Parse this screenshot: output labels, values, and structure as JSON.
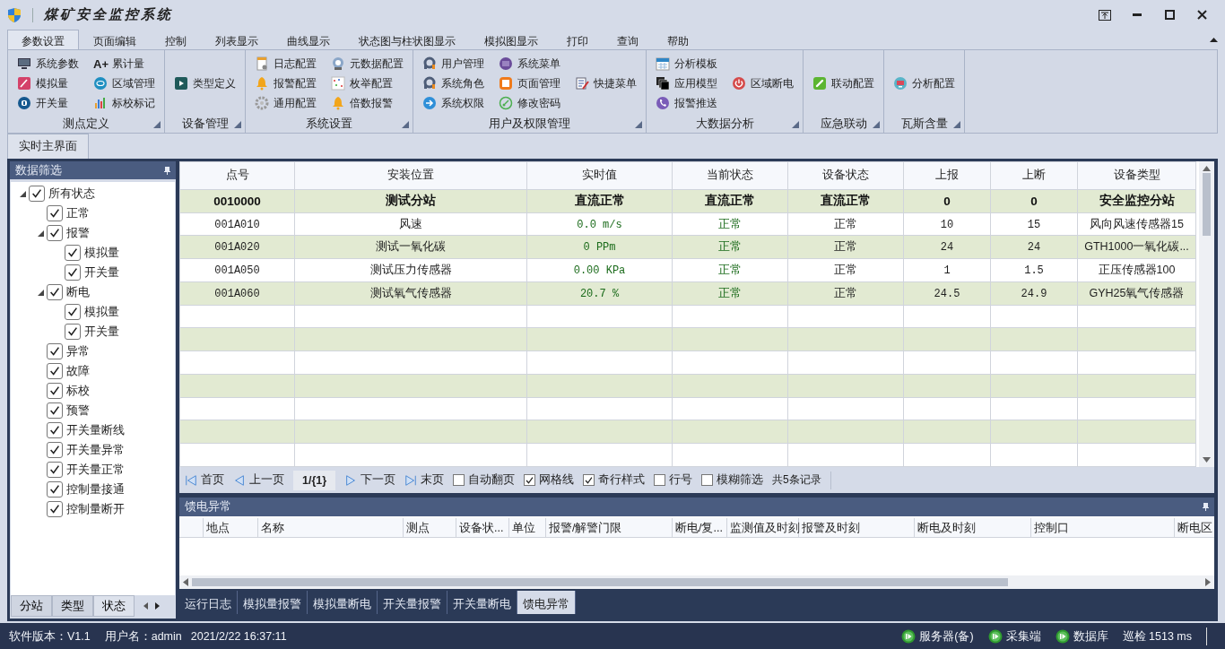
{
  "window": {
    "title": "煤矿安全监控系统"
  },
  "ribbon": {
    "tabs": [
      {
        "label": "参数设置",
        "selected": true
      },
      {
        "label": "页面编辑",
        "selected": false
      },
      {
        "label": "控制",
        "selected": false
      },
      {
        "label": "列表显示",
        "selected": false
      },
      {
        "label": "曲线显示",
        "selected": false
      },
      {
        "label": "状态图与柱状图显示",
        "selected": false
      },
      {
        "label": "模拟图显示",
        "selected": false
      },
      {
        "label": "打印",
        "selected": false
      },
      {
        "label": "查询",
        "selected": false
      },
      {
        "label": "帮助",
        "selected": false
      }
    ],
    "groups": [
      {
        "label": "测点定义",
        "columns": [
          [
            {
              "label": "系统参数"
            },
            {
              "label": "模拟量"
            },
            {
              "label": "开关量"
            }
          ],
          [
            {
              "label": "累计量",
              "icon_text": "A+"
            },
            {
              "label": "区域管理"
            },
            {
              "label": "标校标记"
            }
          ]
        ]
      },
      {
        "label": "设备管理",
        "columns": [
          [
            {
              "label": "类型定义"
            }
          ]
        ]
      },
      {
        "label": "系统设置",
        "columns": [
          [
            {
              "label": "日志配置"
            },
            {
              "label": "报警配置"
            },
            {
              "label": "通用配置"
            }
          ],
          [
            {
              "label": "元数据配置"
            },
            {
              "label": "枚举配置"
            },
            {
              "label": "倍数报警"
            }
          ]
        ]
      },
      {
        "label": "用户及权限管理",
        "columns": [
          [
            {
              "label": "用户管理"
            },
            {
              "label": "系统角色"
            },
            {
              "label": "系统权限"
            }
          ],
          [
            {
              "label": "系统菜单"
            },
            {
              "label": "页面管理"
            },
            {
              "label": "修改密码"
            }
          ],
          [
            {
              "label": "快捷菜单"
            }
          ]
        ]
      },
      {
        "label": "大数据分析",
        "columns": [
          [
            {
              "label": "分析模板"
            },
            {
              "label": "应用模型"
            },
            {
              "label": "报警推送"
            }
          ],
          [
            {
              "label": "区域断电"
            }
          ]
        ]
      },
      {
        "label": "应急联动",
        "columns": [
          [
            {
              "label": "联动配置"
            }
          ]
        ]
      },
      {
        "label": "瓦斯含量",
        "columns": [
          [
            {
              "label": "分析配置"
            }
          ]
        ]
      }
    ]
  },
  "document_tabs": [
    {
      "label": "实时主界面",
      "selected": true
    }
  ],
  "filter_panel": {
    "title": "数据筛选",
    "tree": [
      {
        "label": "所有状态",
        "checked": true,
        "expanded": true,
        "children": [
          {
            "label": "正常",
            "checked": true
          },
          {
            "label": "报警",
            "checked": true,
            "expanded": true,
            "children": [
              {
                "label": "模拟量",
                "checked": true
              },
              {
                "label": "开关量",
                "checked": true
              }
            ]
          },
          {
            "label": "断电",
            "checked": true,
            "expanded": true,
            "children": [
              {
                "label": "模拟量",
                "checked": true
              },
              {
                "label": "开关量",
                "checked": true
              }
            ]
          },
          {
            "label": "异常",
            "checked": true
          },
          {
            "label": "故障",
            "checked": true
          },
          {
            "label": "标校",
            "checked": true
          },
          {
            "label": "预警",
            "checked": true
          },
          {
            "label": "开关量断线",
            "checked": true
          },
          {
            "label": "开关量异常",
            "checked": true
          },
          {
            "label": "开关量正常",
            "checked": true
          },
          {
            "label": "控制量接通",
            "checked": true
          },
          {
            "label": "控制量断开",
            "checked": true
          }
        ]
      }
    ],
    "tabs": [
      {
        "label": "分站",
        "selected": false
      },
      {
        "label": "类型",
        "selected": false
      },
      {
        "label": "状态",
        "selected": true
      }
    ]
  },
  "table": {
    "columns": [
      {
        "label": "点号",
        "kind": "code"
      },
      {
        "label": "安装位置",
        "kind": "text"
      },
      {
        "label": "实时值",
        "kind": "value"
      },
      {
        "label": "当前状态",
        "kind": "status"
      },
      {
        "label": "设备状态",
        "kind": "text"
      },
      {
        "label": "上报",
        "kind": "code"
      },
      {
        "label": "上断",
        "kind": "code"
      },
      {
        "label": "设备类型",
        "kind": "text"
      }
    ],
    "rows": [
      {
        "kind": "station",
        "cells": [
          "0010000",
          "测试分站",
          "直流正常",
          "直流正常",
          "直流正常",
          "0",
          "0",
          "安全监控分站"
        ]
      },
      {
        "kind": "point",
        "cells": [
          "001A010",
          "风速",
          "0.0 m/s",
          "正常",
          "正常",
          "10",
          "15",
          "风向风速传感器15"
        ]
      },
      {
        "kind": "point",
        "cells": [
          "001A020",
          "测试一氧化碳",
          "0 PPm",
          "正常",
          "正常",
          "24",
          "24",
          "GTH1000一氧化碳..."
        ]
      },
      {
        "kind": "point",
        "cells": [
          "001A050",
          "测试压力传感器",
          "0.00 KPa",
          "正常",
          "正常",
          "1",
          "1.5",
          "正压传感器100"
        ]
      },
      {
        "kind": "point",
        "cells": [
          "001A060",
          "测试氧气传感器",
          "20.7 %",
          "正常",
          "正常",
          "24.5",
          "24.9",
          "GYH25氧气传感器"
        ]
      }
    ]
  },
  "pager": {
    "buttons": [
      {
        "label": "首页",
        "kind": "first"
      },
      {
        "label": "上一页",
        "kind": "prev"
      },
      {
        "label": "1/{1}",
        "kind": "page"
      },
      {
        "label": "下一页",
        "kind": "next"
      },
      {
        "label": "末页",
        "kind": "last"
      }
    ],
    "options": [
      {
        "label": "自动翻页",
        "checked": false
      },
      {
        "label": "网格线",
        "checked": true
      },
      {
        "label": "奇行样式",
        "checked": true
      },
      {
        "label": "行号",
        "checked": false
      },
      {
        "label": "模糊筛选",
        "checked": false
      }
    ],
    "summary": "共5条记录"
  },
  "feed_panel": {
    "title": "馈电异常",
    "columns": [
      "地点",
      "名称",
      "测点",
      "设备状...",
      "单位",
      "报警/解警门限",
      "断电/复...",
      "监测值及时刻",
      "报警及时刻",
      "断电及时刻",
      "控制口",
      "断电区"
    ]
  },
  "bottom_tabs": [
    {
      "label": "运行日志",
      "selected": false
    },
    {
      "label": "模拟量报警",
      "selected": false
    },
    {
      "label": "模拟量断电",
      "selected": false
    },
    {
      "label": "开关量报警",
      "selected": false
    },
    {
      "label": "开关量断电",
      "selected": false
    },
    {
      "label": "馈电异常",
      "selected": true
    }
  ],
  "status_bar": {
    "version": "软件版本：V1.1",
    "user": "用户名：admin",
    "time": "2021/2/22 16:37:11",
    "services": [
      "服务器(备)",
      "采集端",
      "数据库"
    ],
    "inspection": "巡检 1513 ms"
  }
}
